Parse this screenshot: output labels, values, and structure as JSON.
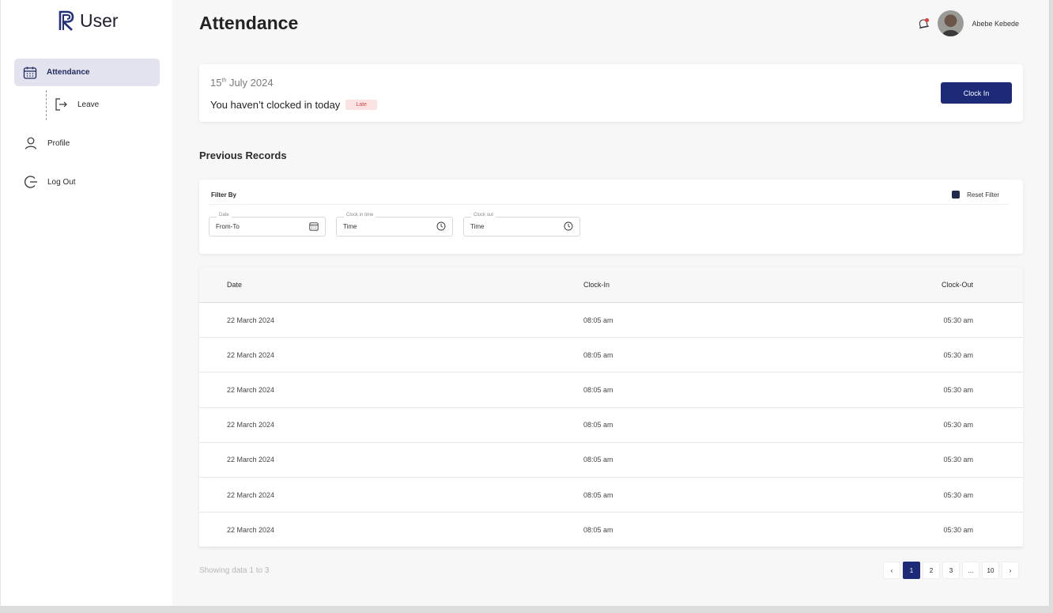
{
  "sidebar": {
    "brand": "User",
    "items": [
      {
        "label": "Attendance",
        "icon": "calendar-icon"
      },
      {
        "label": "Leave",
        "icon": "leave-icon"
      },
      {
        "label": "Profile",
        "icon": "user-icon"
      },
      {
        "label": "Log Out",
        "icon": "logout-icon"
      }
    ]
  },
  "header": {
    "title": "Attendance",
    "user_name": "Abebe Kebede"
  },
  "today": {
    "day": "15",
    "day_suffix": "th",
    "month_year": "July 2024",
    "message": "You haven’t clocked in today",
    "badge": "Late",
    "button": "Clock In"
  },
  "records": {
    "title": "Previous Records",
    "filter": {
      "label": "Filter By",
      "reset": "Reset Filter",
      "fields": [
        {
          "label": "Date",
          "value": "From-To"
        },
        {
          "label": "Clock in time",
          "value": "Time"
        },
        {
          "label": "Clock out",
          "value": "Time"
        }
      ]
    },
    "columns": [
      "Date",
      "Clock-In",
      "Clock-Out"
    ],
    "rows": [
      [
        "22 March 2024",
        "08:05 am",
        "05:30 am"
      ],
      [
        "22 March 2024",
        "08:05 am",
        "05:30 am"
      ],
      [
        "22 March 2024",
        "08:05 am",
        "05:30 am"
      ],
      [
        "22 March 2024",
        "08:05 am",
        "05:30 am"
      ],
      [
        "22 March 2024",
        "08:05 am",
        "05:30 am"
      ],
      [
        "22 March 2024",
        "08:05 am",
        "05:30 am"
      ],
      [
        "22 March 2024",
        "08:05 am",
        "05:30 am"
      ]
    ],
    "showing": "Showing data 1 to 3",
    "pagination": {
      "prev": "‹",
      "pages": [
        "1",
        "2",
        "3",
        "...",
        "10"
      ],
      "next": "›",
      "current": "1"
    }
  },
  "colors": {
    "accent": "#1c2a78",
    "active_nav_bg": "#e2e3ef",
    "late_badge_bg": "#fbe3e3",
    "late_badge_text": "#d24545",
    "notification_dot": "#e23b3b"
  }
}
